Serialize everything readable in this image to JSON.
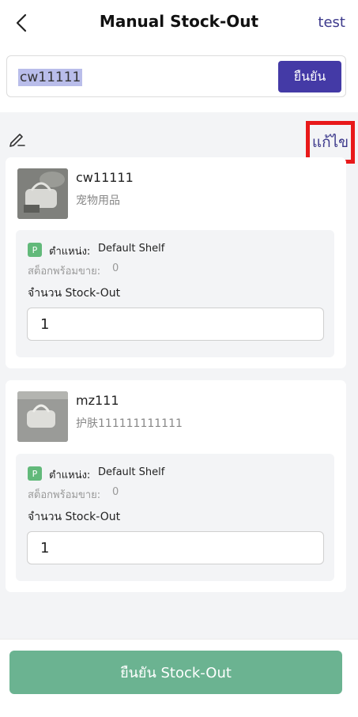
{
  "header": {
    "title": "Manual Stock-Out",
    "right_link": "test"
  },
  "search": {
    "value": "cw11111",
    "confirm_label": "ยืนยัน"
  },
  "toolbar": {
    "edit_label": "แก้ไข"
  },
  "products": [
    {
      "code": "cw11111",
      "name": "宠物用品",
      "location_badge": "P",
      "location_label": "ตำแหน่ง:",
      "location_value": "Default Shelf",
      "available_label": "สต็อกพร้อมขาย:",
      "available_value": "0",
      "qty_label": "จำนวน Stock-Out",
      "qty_value": "1"
    },
    {
      "code": "mz111",
      "name": "护肤111111111111",
      "location_badge": "P",
      "location_label": "ตำแหน่ง:",
      "location_value": "Default Shelf",
      "available_label": "สต็อกพร้อมขาย:",
      "available_value": "0",
      "qty_label": "จำนวน Stock-Out",
      "qty_value": "1"
    }
  ],
  "footer": {
    "submit_label": "ยืนยัน Stock-Out"
  },
  "colors": {
    "accent": "#443aa6",
    "link": "#3d3a8c",
    "success": "#6bb391",
    "badge": "#62b97a",
    "highlight": "#e8191a"
  },
  "icons": {
    "back": "back-arrow-icon",
    "edit": "pencil-icon",
    "annotation": "red-arrow-icon"
  }
}
